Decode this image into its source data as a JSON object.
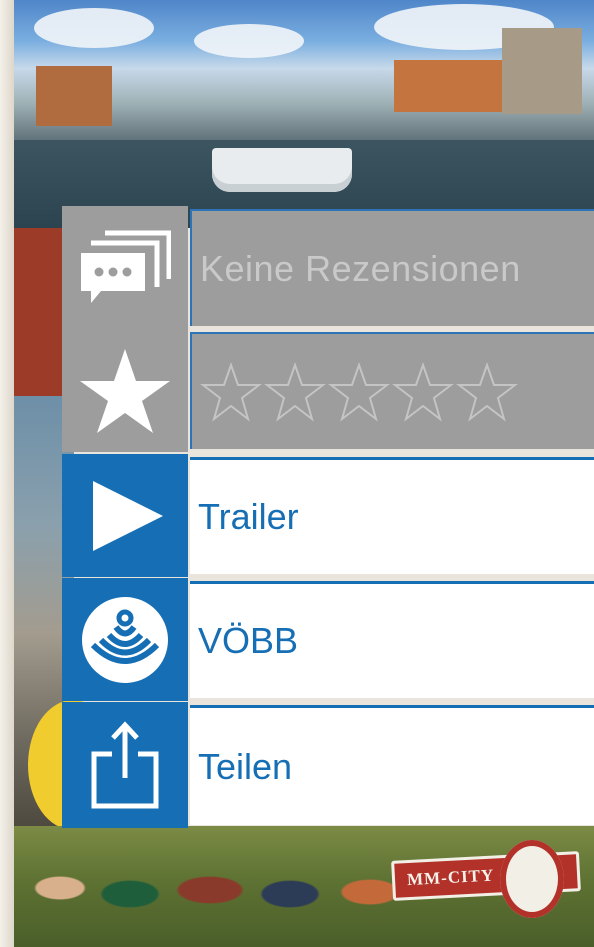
{
  "menu": {
    "reviews": {
      "label": "Keine Rezensionen",
      "icon": "chat-bubbles-icon"
    },
    "rating": {
      "value": 0,
      "max": 5,
      "icon": "star-icon"
    },
    "trailer": {
      "label": "Trailer",
      "icon": "play-icon"
    },
    "voebb": {
      "label": "VÖBB",
      "icon": "voebb-logo-icon"
    },
    "share": {
      "label": "Teilen",
      "icon": "share-icon"
    }
  },
  "cover": {
    "logo_text": "MM-CITY"
  },
  "colors": {
    "accent_blue": "#166fb4",
    "inactive_gray": "#9d9d9d",
    "inactive_text": "#c9c9c9"
  }
}
